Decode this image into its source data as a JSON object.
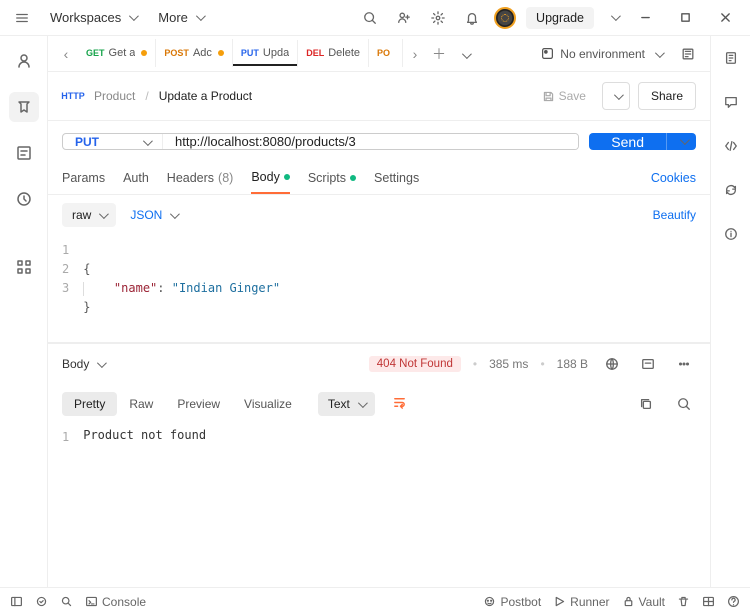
{
  "titlebar": {
    "workspaces": "Workspaces",
    "more": "More",
    "upgrade": "Upgrade"
  },
  "tabs": [
    {
      "method": "GET",
      "method_class": "method-get",
      "name": "Get a",
      "dirty": true
    },
    {
      "method": "POST",
      "method_class": "method-post",
      "name": "Adc",
      "dirty": true
    },
    {
      "method": "PUT",
      "method_class": "method-put",
      "name": "Upda",
      "dirty": false,
      "active": true
    },
    {
      "method": "DEL",
      "method_class": "method-del",
      "name": "Delete",
      "dirty": false
    },
    {
      "method": "PO",
      "method_class": "method-post",
      "name": "",
      "dirty": false
    }
  ],
  "environment": {
    "label": "No environment"
  },
  "breadcrumb": {
    "collection": "Product",
    "request": "Update a Product"
  },
  "actions": {
    "save": "Save",
    "share": "Share"
  },
  "request": {
    "method": "PUT",
    "url": "http://localhost:8080/products/3",
    "send": "Send"
  },
  "req_tabs": {
    "params": "Params",
    "auth": "Auth",
    "headers": "Headers",
    "headers_count": "(8)",
    "body": "Body",
    "scripts": "Scripts",
    "settings": "Settings",
    "cookies": "Cookies"
  },
  "body_ctl": {
    "raw": "raw",
    "format": "JSON",
    "beautify": "Beautify"
  },
  "body_code": {
    "line1": "{",
    "key": "\"name\"",
    "colon": ": ",
    "val": "\"Indian Ginger\"",
    "line3": "}"
  },
  "response": {
    "label": "Body",
    "status": "404 Not Found",
    "time": "385 ms",
    "size": "188 B"
  },
  "view_tabs": {
    "pretty": "Pretty",
    "raw": "Raw",
    "preview": "Preview",
    "visualize": "Visualize",
    "fmt": "Text"
  },
  "response_body": "Product not found",
  "statusbar": {
    "console": "Console",
    "postbot": "Postbot",
    "runner": "Runner",
    "vault": "Vault"
  }
}
